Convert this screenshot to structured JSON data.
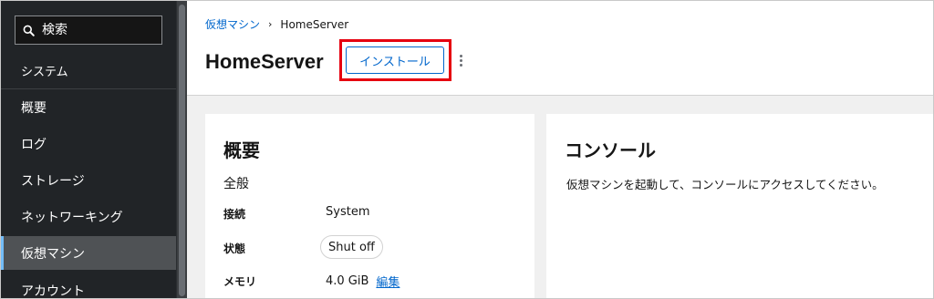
{
  "sidebar": {
    "search": {
      "placeholder": "検索"
    },
    "section_label": "システム",
    "items": [
      {
        "label": "概要"
      },
      {
        "label": "ログ"
      },
      {
        "label": "ストレージ"
      },
      {
        "label": "ネットワーキング"
      },
      {
        "label": "仮想マシン",
        "active": true
      },
      {
        "label": "アカウント"
      }
    ]
  },
  "header": {
    "breadcrumb": {
      "parent": "仮想マシン",
      "separator": "›",
      "current": "HomeServer"
    },
    "title": "HomeServer",
    "install_label": "インストール",
    "highlight_color": "#e6000f"
  },
  "overview": {
    "title": "概要",
    "section": "全般",
    "props": [
      {
        "label": "接続",
        "value": "System"
      },
      {
        "label": "状態",
        "value": "Shut off"
      },
      {
        "label": "メモリ",
        "value": "4.0 GiB",
        "action": "編集"
      }
    ]
  },
  "console": {
    "title": "コンソール",
    "message": "仮想マシンを起動して、コンソールにアクセスしてください。"
  },
  "colors": {
    "sidebar_bg": "#212427",
    "link": "#0066cc",
    "active_indicator": "#73bcf7"
  }
}
